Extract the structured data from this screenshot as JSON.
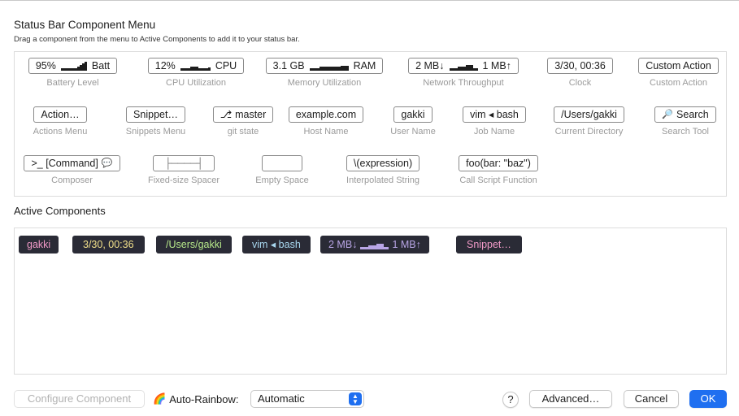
{
  "header": {
    "title": "Status Bar Component Menu",
    "subtitle": "Drag a component from the menu to Active Components to add it to your status bar."
  },
  "palette": {
    "battery": {
      "prefix": "95%",
      "suffix": "Batt",
      "label": "Battery Level"
    },
    "cpu": {
      "prefix": "12%",
      "suffix": "CPU",
      "label": "CPU Utilization"
    },
    "memory": {
      "prefix": "3.1 GB",
      "suffix": "RAM",
      "label": "Memory Utilization"
    },
    "network": {
      "prefix": "2 MB↓",
      "suffix": "1 MB↑",
      "label": "Network Throughput"
    },
    "clock": {
      "text": "3/30, 00:36",
      "label": "Clock"
    },
    "custom_action": {
      "text": "Custom Action",
      "label": "Custom Action"
    },
    "actions_menu": {
      "text": "Action…",
      "label": "Actions Menu"
    },
    "snippets_menu": {
      "text": "Snippet…",
      "label": "Snippets Menu"
    },
    "git_state": {
      "text": "master",
      "icon": "⎇",
      "label": "git state"
    },
    "host_name": {
      "text": "example.com",
      "label": "Host Name"
    },
    "user_name": {
      "text": "gakki",
      "label": "User Name"
    },
    "job_name": {
      "text": "vim ◂ bash",
      "label": "Job Name"
    },
    "current_dir": {
      "text": "/Users/gakki",
      "label": "Current Directory"
    },
    "search_tool": {
      "text": "Search",
      "icon": "🔎",
      "label": "Search Tool"
    },
    "composer": {
      "text": ">_ [Command]",
      "icon": "💬",
      "label": "Composer"
    },
    "fixed_spacer": {
      "text": "├────┤",
      "label": "Fixed-size Spacer"
    },
    "empty_space": {
      "text": "",
      "label": "Empty Space"
    },
    "interpolated": {
      "text": "\\(expression)",
      "label": "Interpolated String"
    },
    "call_script": {
      "text": "foo(bar: \"baz\")",
      "label": "Call Script Function"
    }
  },
  "active": {
    "title": "Active Components",
    "items": [
      {
        "text": "gakki",
        "color": "#f29ac8"
      },
      {
        "text": "3/30, 00:36",
        "color": "#f2e08a"
      },
      {
        "text": "/Users/gakki",
        "color": "#b7e98a"
      },
      {
        "text": "vim ◂ bash",
        "color": "#a9d8f0"
      },
      {
        "prefix": "2 MB↓",
        "suffix": "1 MB↑",
        "color": "#b9a6e6"
      },
      {
        "text": "Snippet…",
        "color": "#f29ac8"
      }
    ]
  },
  "footer": {
    "configure": "Configure Component",
    "rainbow_icon": "🌈",
    "rainbow_label": "Auto-Rainbow:",
    "rainbow_value": "Automatic",
    "help": "?",
    "advanced": "Advanced…",
    "cancel": "Cancel",
    "ok": "OK"
  },
  "colors": {
    "accent": "#1f6ff0",
    "chip_bg": "#2a2b36"
  }
}
